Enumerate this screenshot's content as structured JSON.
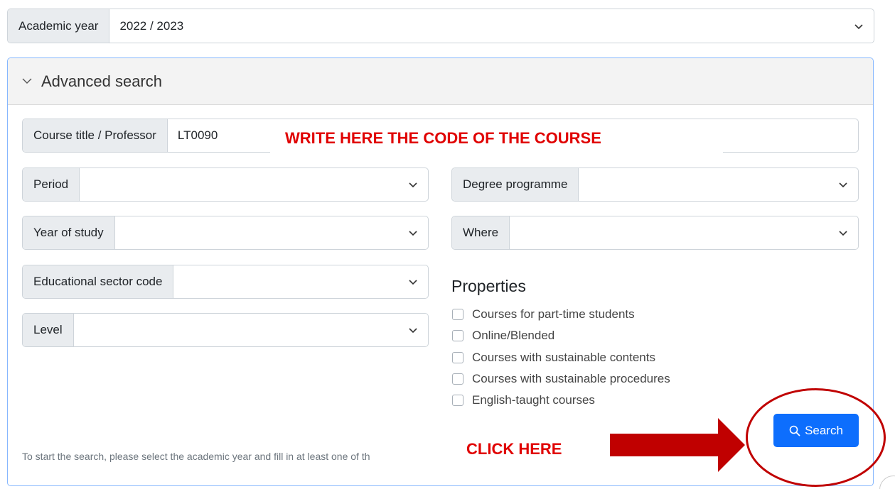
{
  "academic_year": {
    "label": "Academic year",
    "value": "2022 / 2023"
  },
  "advanced_search": {
    "header": "Advanced search",
    "course_title": {
      "label": "Course title / Professor",
      "value": "LT0090"
    },
    "period": {
      "label": "Period",
      "value": ""
    },
    "degree_programme": {
      "label": "Degree programme",
      "value": ""
    },
    "year_of_study": {
      "label": "Year of study",
      "value": ""
    },
    "where": {
      "label": "Where",
      "value": ""
    },
    "educational_sector_code": {
      "label": "Educational sector code",
      "value": ""
    },
    "level": {
      "label": "Level",
      "value": ""
    },
    "properties": {
      "title": "Properties",
      "options": [
        "Courses for part-time students",
        "Online/Blended",
        "Courses with sustainable contents",
        "Courses with sustainable procedures",
        "English-taught courses"
      ]
    },
    "search_button": "Search",
    "hint": "To start the search, please select the academic year and fill in at least one of th"
  },
  "annotations": {
    "write_here": "WRITE HERE THE CODE OF THE COURSE",
    "click_here": "CLICK HERE",
    "color": "#e00000",
    "arrow_color": "#c00000"
  },
  "icons": {
    "chevron": "chevron-down-icon",
    "search": "search-icon"
  }
}
